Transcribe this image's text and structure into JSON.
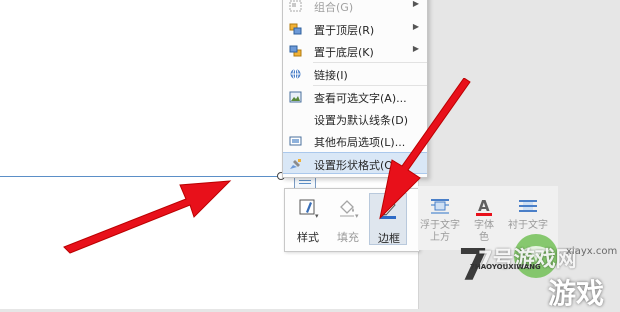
{
  "context_menu": {
    "items": [
      {
        "label": "组合(G)",
        "icon": "group-icon",
        "submenu": true,
        "disabled": true
      },
      {
        "label": "置于顶层(R)",
        "icon": "bring-to-front-icon",
        "submenu": true
      },
      {
        "label": "置于底层(K)",
        "icon": "send-to-back-icon",
        "submenu": true
      },
      {
        "label": "链接(I)",
        "icon": "link-icon"
      },
      {
        "label": "查看可选文字(A)...",
        "icon": "alt-text-icon"
      },
      {
        "label": "设置为默认线条(D)",
        "icon": ""
      },
      {
        "label": "其他布局选项(L)...",
        "icon": "layout-options-icon"
      },
      {
        "label": "设置形状格式(O)...",
        "icon": "format-shape-icon",
        "highlighted": true
      }
    ]
  },
  "mini_toolbar": {
    "style_label": "样式",
    "fill_label": "填充",
    "border_label": "边框",
    "border_color": "#2e6bc6"
  },
  "ribbon": {
    "float_label_1": "浮于文字",
    "float_label_2": "上方",
    "font_label_1": "字体",
    "font_label_2": "色",
    "wrap_label": "衬于文字"
  },
  "watermark": {
    "brand": "7号游戏网",
    "sub": "7HAOYOUXIWANG",
    "site": "xiayx.com",
    "big": "游戏"
  },
  "colors": {
    "arrow": "#e8101a",
    "menu_highlight": "#d9e7f6",
    "line": "#5b8fc7"
  }
}
